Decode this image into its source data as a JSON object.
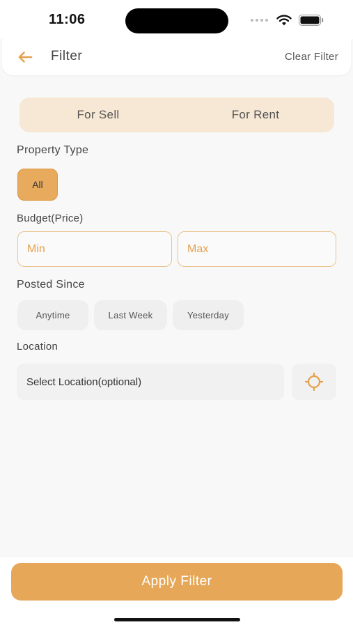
{
  "status_bar": {
    "time": "11:06"
  },
  "header": {
    "title": "Filter",
    "clear_label": "Clear Filter"
  },
  "listing_type": {
    "options": [
      "For Sell",
      "For Rent"
    ]
  },
  "property_type": {
    "label": "Property Type",
    "options": [
      "All"
    ],
    "selected": "All"
  },
  "budget": {
    "label": "Budget(Price)",
    "min_placeholder": "Min",
    "max_placeholder": "Max"
  },
  "posted_since": {
    "label": "Posted Since",
    "options": [
      "Anytime",
      "Last Week",
      "Yesterday"
    ]
  },
  "location": {
    "label": "Location",
    "placeholder": "Select Location(optional)"
  },
  "apply_button": {
    "label": "Apply Filter"
  },
  "colors": {
    "accent": "#e6a858",
    "accent_text": "#e6a04c",
    "segment_bg": "#f7e8d5",
    "chip_bg": "#efefef",
    "background": "#f8f8f8"
  },
  "icons": {
    "back": "arrow-left-icon",
    "locate": "crosshair-icon",
    "wifi": "wifi-icon",
    "battery": "battery-icon",
    "signal": "cellular-signal-icon"
  }
}
